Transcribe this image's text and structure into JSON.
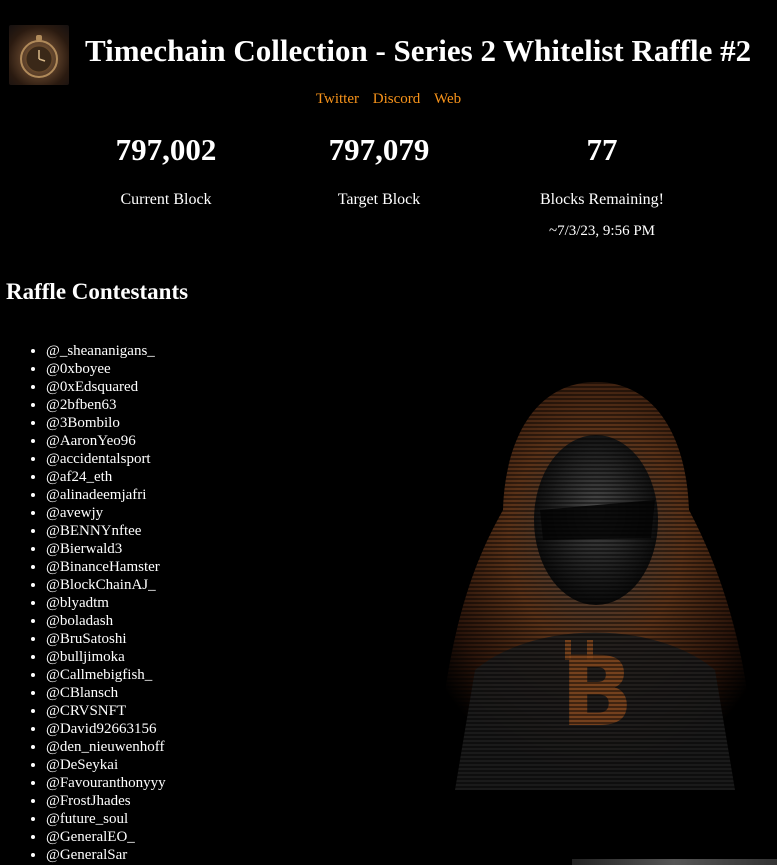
{
  "header": {
    "title": "Timechain Collection - Series 2 Whitelist Raffle #2"
  },
  "links": [
    {
      "label": "Twitter"
    },
    {
      "label": "Discord"
    },
    {
      "label": "Web"
    }
  ],
  "stats": {
    "current_block": {
      "value": "797,002",
      "label": "Current Block"
    },
    "target_block": {
      "value": "797,079",
      "label": "Target Block"
    },
    "remaining": {
      "value": "77",
      "label": "Blocks Remaining!",
      "eta": "~7/3/23, 9:56 PM"
    }
  },
  "contestants": {
    "heading": "Raffle Contestants",
    "items": [
      "@_sheananigans_",
      "@0xboyee",
      "@0xEdsquared",
      "@2bfben63",
      "@3Bombilo",
      "@AaronYeo96",
      "@accidentalsport",
      "@af24_eth",
      "@alinadeemjafri",
      "@avewjy",
      "@BENNYnftee",
      "@Bierwald3",
      "@BinanceHamster",
      "@BlockChainAJ_",
      "@blyadtm",
      "@boladash",
      "@BruSatoshi",
      "@bulljimoka",
      "@Callmebigfish_",
      "@CBlansch",
      "@CRVSNFT",
      "@David92663156",
      "@den_nieuwenhoff",
      "@DeSeykai",
      "@Favouranthonyyy",
      "@FrostJhades",
      "@future_soul",
      "@GeneralEO_",
      "@GeneralSar"
    ]
  },
  "colors": {
    "background": "#000000",
    "text": "#ffffff",
    "link": "#f7931a"
  }
}
